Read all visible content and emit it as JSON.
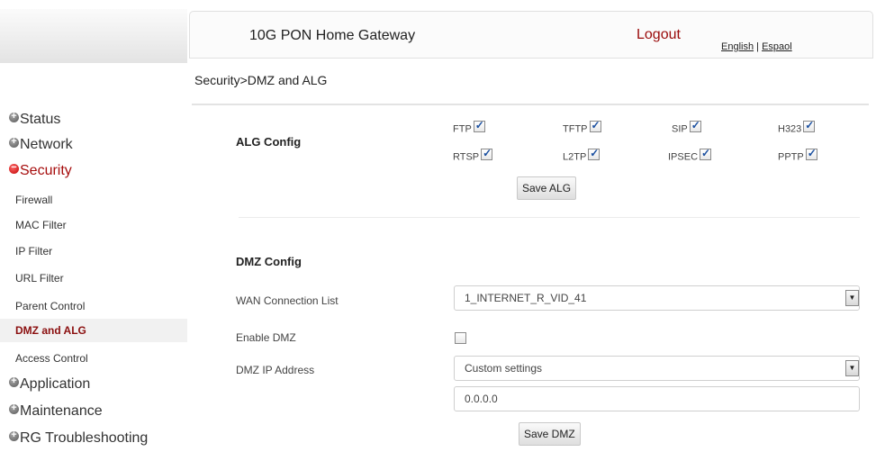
{
  "header": {
    "title": "10G PON Home Gateway",
    "logout": "Logout",
    "lang_english": "English",
    "lang_separator": "|",
    "lang_espanol": "Espaol"
  },
  "breadcrumb": "Security>DMZ and ALG",
  "nav": {
    "status": "Status",
    "network": "Network",
    "security": "Security",
    "sub": {
      "firewall": "Firewall",
      "mac_filter": "MAC Filter",
      "ip_filter": "IP Filter",
      "url_filter": "URL Filter",
      "parent_control": "Parent Control",
      "dmz_alg": "DMZ and ALG",
      "access_control": "Access Control"
    },
    "application": "Application",
    "maintenance": "Maintenance",
    "rg_troubleshooting": "RG Troubleshooting"
  },
  "alg": {
    "heading": "ALG Config",
    "items": {
      "ftp": "FTP",
      "tftp": "TFTP",
      "sip": "SIP",
      "h323": "H323",
      "rtsp": "RTSP",
      "l2tp": "L2TP",
      "ipsec": "IPSEC",
      "pptp": "PPTP"
    },
    "save": "Save ALG"
  },
  "dmz": {
    "heading": "DMZ Config",
    "wan_label": "WAN Connection List",
    "wan_value": "1_INTERNET_R_VID_41",
    "enable_label": "Enable DMZ",
    "ip_label": "DMZ IP Address",
    "ip_mode": "Custom settings",
    "ip_value": "0.0.0.0",
    "save": "Save DMZ"
  },
  "colors": {
    "active_nav": "#a60d0d",
    "logout": "#9a0a0a",
    "checkbox_check": "#1a4fa0"
  }
}
